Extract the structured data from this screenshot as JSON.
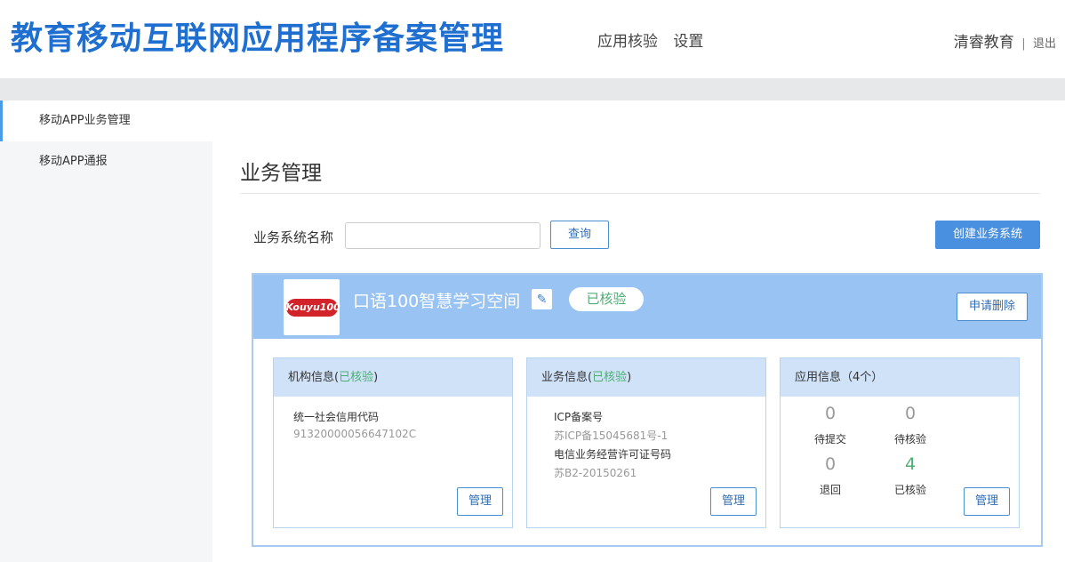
{
  "header": {
    "site_title": "教育移动互联网应用程序备案管理",
    "nav": [
      "应用核验",
      "设置"
    ],
    "user_name": "清睿教育",
    "separator": "|",
    "logout": "退出"
  },
  "sidebar": {
    "items": [
      {
        "label": "移动APP业务管理",
        "active": true
      },
      {
        "label": "移动APP通报",
        "active": false
      }
    ]
  },
  "main": {
    "page_title": "业务管理",
    "search": {
      "label": "业务系统名称",
      "value": "",
      "placeholder": "",
      "query_label": "查询"
    },
    "create_label": "创建业务系统"
  },
  "app_card": {
    "logo_text": "Kouyu100",
    "name": "口语100智慧学习空间",
    "status": "已核验",
    "delete_label": "申请删除",
    "org_info": {
      "title": "机构信息(",
      "status": "已核验",
      "title_end": ")",
      "fields": [
        {
          "label": "统一社会信用代码",
          "value": "91320000056647102C"
        }
      ],
      "manage_label": "管理"
    },
    "biz_info": {
      "title": "业务信息(",
      "status": "已核验",
      "title_end": ")",
      "fields": [
        {
          "label": "ICP备案号",
          "value": "苏ICP备15045681号-1"
        },
        {
          "label": "电信业务经营许可证号码",
          "value": "苏B2-20150261"
        }
      ],
      "manage_label": "管理"
    },
    "app_info": {
      "title": "应用信息（4个）",
      "stats": [
        {
          "value": "0",
          "label": "待提交"
        },
        {
          "value": "0",
          "label": "待核验"
        },
        {
          "value": "0",
          "label": "退回"
        },
        {
          "value": "4",
          "label": "已核验"
        }
      ],
      "manage_label": "管理"
    }
  },
  "colors": {
    "brand": "#1e6fd0",
    "card_head": "#99c3f2",
    "verified": "#4cae74",
    "button": "#4a90e0"
  }
}
